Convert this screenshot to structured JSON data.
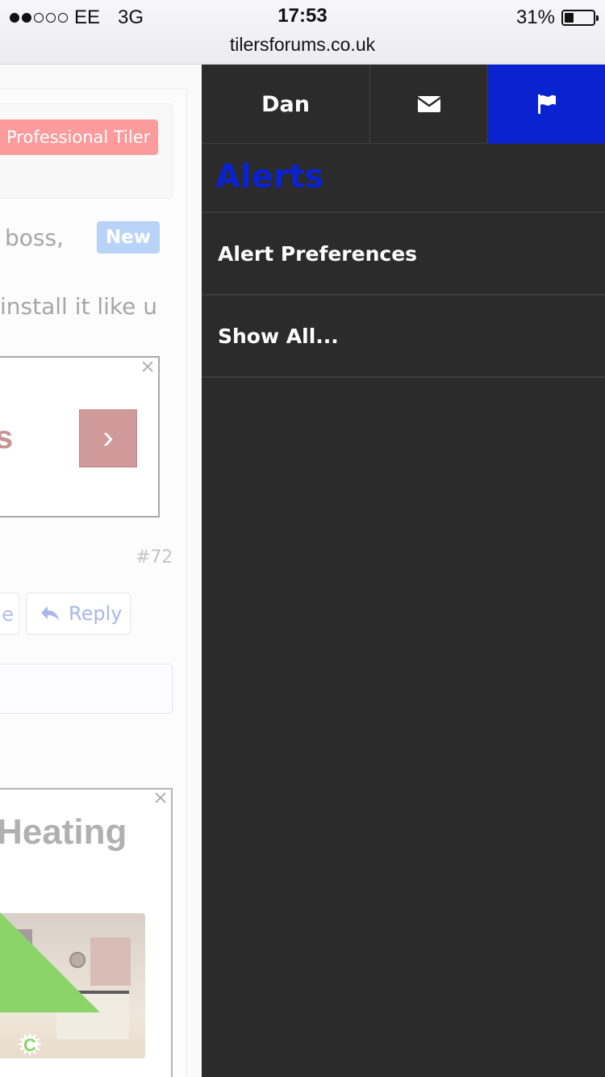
{
  "status_bar": {
    "carrier": "EE",
    "network": "3G",
    "time": "17:53",
    "battery_percent": "31%",
    "battery_level": 0.31,
    "signal_bars_filled": 2,
    "signal_bars_total": 5,
    "url": "tilersforums.co.uk"
  },
  "background_page": {
    "user_badge": "Professional Tiler",
    "snippet_line1": "boss,",
    "new_badge": "New",
    "snippet_line2": "install it like u",
    "ad1_partial_text": "s",
    "post_number": "#72",
    "partial_button_text": "e",
    "reply_label": "Reply",
    "ad2_partial_title": "Heating"
  },
  "drawer": {
    "user_tab_label": "Dan",
    "heading": "Alerts",
    "items": [
      {
        "label": "Alert Preferences"
      },
      {
        "label": "Show All..."
      }
    ]
  },
  "colors": {
    "drawer_bg": "#2b2b2b",
    "active_tab": "#0a22d0",
    "heading": "#0a22d0"
  },
  "icons": {
    "mail_tab": "envelope-icon",
    "alerts_tab": "flag-icon",
    "reply": "reply-arrow-icon",
    "ad_close": "close-icon",
    "ad_next": "chevron-right-icon",
    "corner": "gear-icon"
  }
}
